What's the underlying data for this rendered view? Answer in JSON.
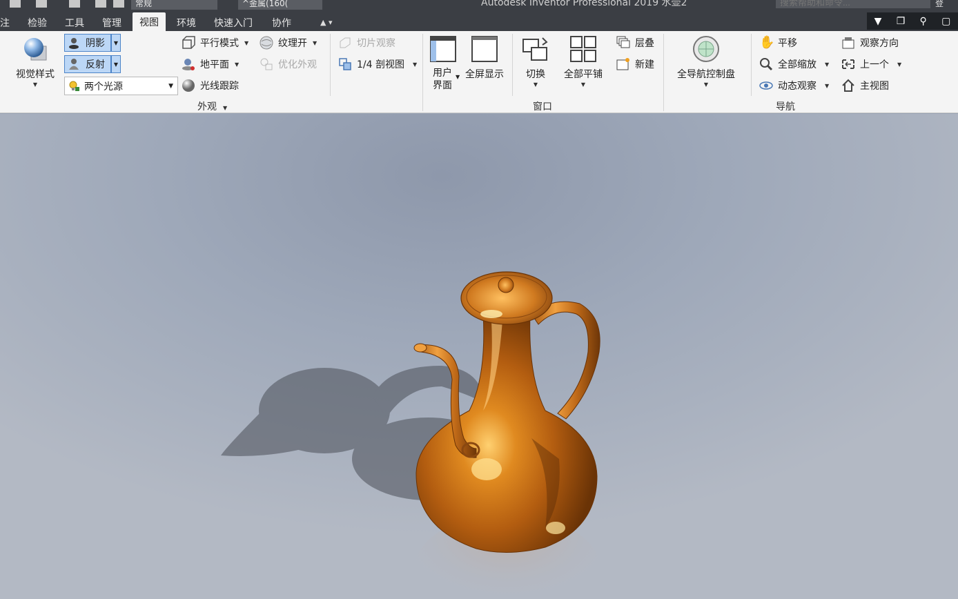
{
  "titlebar": {
    "appearance_combo": "常规",
    "material_combo": "^金属(160(",
    "title": "Autodesk Inventor Professional 2019    水壶2",
    "search_placeholder": "搜索帮助和命令...",
    "user_fragment": "登"
  },
  "tabs": [
    {
      "label": "注"
    },
    {
      "label": "检验"
    },
    {
      "label": "工具"
    },
    {
      "label": "管理"
    },
    {
      "label": "视图",
      "active": true
    },
    {
      "label": "环境"
    },
    {
      "label": "快速入门"
    },
    {
      "label": "协作"
    }
  ],
  "ribbon": {
    "appearance": {
      "visual_style_label": "视觉样式",
      "shadow_label": "阴影",
      "reflection_label": "反射",
      "lighting_value": "两个光源",
      "parallel_mode_label": "平行模式",
      "ground_plane_label": "地平面",
      "ray_tracing_label": "光线跟踪",
      "texture_on_label": "纹理开",
      "optimize_appearance_label": "优化外观",
      "panel_title": "外观"
    },
    "section": {
      "slice_label": "切片观察",
      "quarter_section_label": "1/4 剖视图"
    },
    "window": {
      "user_interface_label_1": "用户",
      "user_interface_label_2": "界面",
      "fullscreen_label": "全屏显示",
      "switch_label": "切换",
      "tile_all_label": "全部平铺",
      "cascade_label": "层叠",
      "new_label": "新建",
      "panel_title": "窗口"
    },
    "navigation": {
      "full_nav_wheel_label": "全导航控制盘",
      "pan_label": "平移",
      "zoom_all_label": "全部缩放",
      "orbit_label": "动态观察",
      "look_at_label": "观察方向",
      "previous_label": "上一个",
      "home_view_label": "主视图",
      "panel_title": "导航"
    }
  },
  "colors": {
    "ribbon_bg": "#f4f4f4",
    "titlebar_bg": "#3b3e44",
    "toggle_active": "#bcd7f6",
    "toggle_border": "#4d84c8",
    "copper": "#c8741c"
  }
}
